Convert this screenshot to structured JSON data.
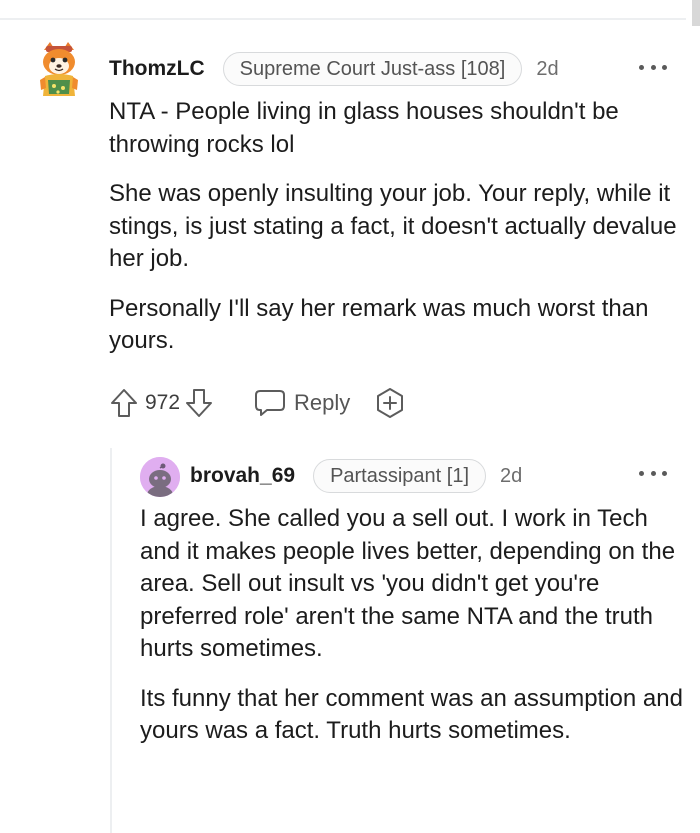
{
  "comment": {
    "username": "ThomzLC",
    "flair": "Supreme Court Just-ass [108]",
    "time": "2d",
    "paragraphs": [
      "NTA - People living in glass houses shouldn't be throwing rocks lol",
      "She was openly insulting your job. Your reply, while it stings, is just stating a fact, it doesn't actually devalue her job.",
      "Personally I'll say her remark was much worst than yours."
    ],
    "score": "972",
    "reply_label": "Reply",
    "icons": {
      "upvote": "arrow-up-icon",
      "downvote": "arrow-down-icon",
      "reply": "speech-bubble-icon",
      "award": "award-plus-icon",
      "more": "more-dots-icon"
    }
  },
  "reply": {
    "username": "brovah_69",
    "flair": "Partassipant [1]",
    "time": "2d",
    "paragraphs": [
      "I agree. She called you a sell out. I work in Tech and it makes people lives better, depending on the area. Sell out insult vs 'you didn't get you're preferred role' aren't the same NTA and the truth hurts sometimes.",
      "Its funny that her comment was an assumption and yours was a fact. Truth hurts sometimes."
    ]
  },
  "colors": {
    "text": "#1c1c1c",
    "meta": "#6d6d6d",
    "divider": "#edeff1",
    "avatar_bg": "#e0aef0"
  }
}
